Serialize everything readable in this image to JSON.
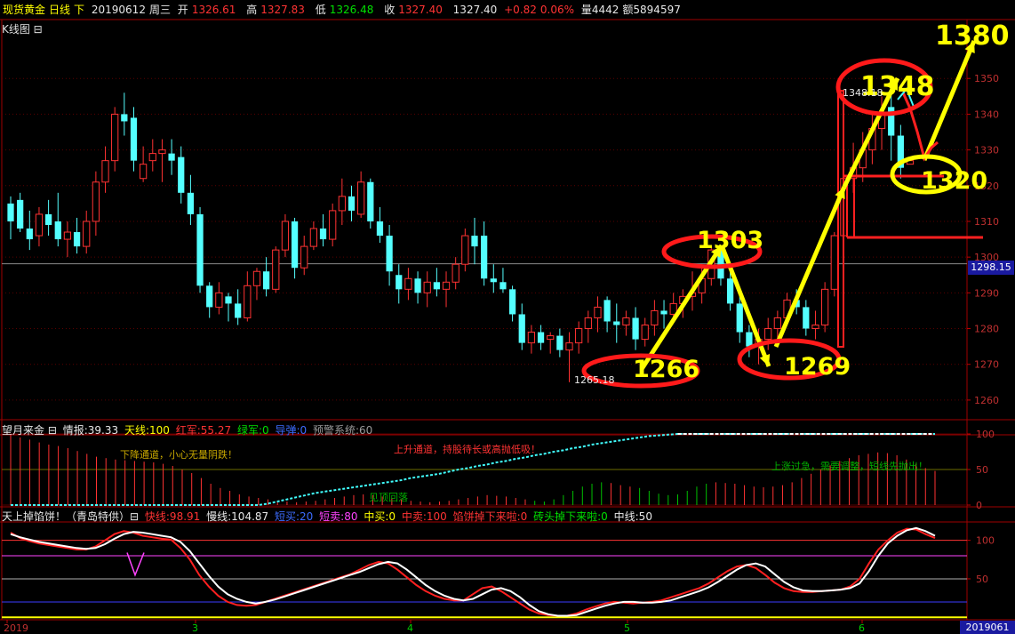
{
  "infobar": {
    "name": "现货黄金",
    "period": "日线",
    "dir": "下",
    "date": "20190612",
    "weekday": "周三",
    "open_label": "开",
    "open": "1326.61",
    "high_label": "高",
    "high": "1327.83",
    "low_label": "低",
    "low": "1326.48",
    "close_label": "收",
    "close": "1327.40",
    "last": "1327.40",
    "change": "+0.82",
    "change_pct": "0.06%",
    "volume": "量4442",
    "amount": "额5894597"
  },
  "kline_label": "K线图 ⊟",
  "price_box": "1298.15",
  "date_box": "2019061",
  "indicator1": {
    "name": "望月来金 ⊟",
    "items": [
      {
        "text": "情报:39.33",
        "color": "#e8e8e8"
      },
      {
        "text": "天线:100",
        "color": "#ffff00"
      },
      {
        "text": "红军:55.27",
        "color": "#ff3333"
      },
      {
        "text": "绿军:0",
        "color": "#00e000"
      },
      {
        "text": "导弹:0",
        "color": "#3c6cff"
      },
      {
        "text": "预警系统:60",
        "color": "#9a9a9a"
      }
    ],
    "notes": [
      "下降通道，小心无量阴跌！",
      "上升通道，持股待长或高抛低吸！",
      "上涨过急，需要调整，短线先抛出！",
      "见顶回落"
    ]
  },
  "indicator2": {
    "name": "天上掉馅饼！（青岛特供）⊟",
    "items": [
      {
        "text": "快线:98.91",
        "color": "#ff3333"
      },
      {
        "text": "慢线:104.87",
        "color": "#e8e8e8"
      },
      {
        "text": "短买:20",
        "color": "#3c6cff"
      },
      {
        "text": "短卖:80",
        "color": "#ff44ff"
      },
      {
        "text": "中买:0",
        "color": "#ffff00"
      },
      {
        "text": "中卖:100",
        "color": "#ff3333"
      },
      {
        "text": "馅饼掉下来啦:0",
        "color": "#ff3333"
      },
      {
        "text": "砖头掉下来啦:0",
        "color": "#00e000"
      },
      {
        "text": "中线:50",
        "color": "#e8e8e8"
      }
    ]
  },
  "xaxis": [
    "2019",
    "3",
    "4",
    "5",
    "6"
  ],
  "annotations": {
    "labels": [
      "1380",
      "1348",
      "1303",
      "1320",
      "1266",
      "1269"
    ],
    "mini_labels": [
      "1348.18",
      "1265.18"
    ]
  },
  "chart_data": {
    "type": "candlestick",
    "title": "现货黄金 日线",
    "price_axis": [
      1260,
      1270,
      1280,
      1290,
      1300,
      1310,
      1320,
      1330,
      1340,
      1350
    ],
    "ylim": [
      1255,
      1362
    ],
    "candles": [
      {
        "o": 1315,
        "h": 1317,
        "l": 1305,
        "c": 1310
      },
      {
        "o": 1316,
        "h": 1318,
        "l": 1307,
        "c": 1308
      },
      {
        "o": 1308,
        "h": 1313,
        "l": 1302,
        "c": 1305
      },
      {
        "o": 1306,
        "h": 1314,
        "l": 1303,
        "c": 1312
      },
      {
        "o": 1312,
        "h": 1316,
        "l": 1306,
        "c": 1309
      },
      {
        "o": 1310,
        "h": 1318,
        "l": 1303,
        "c": 1305
      },
      {
        "o": 1305,
        "h": 1310,
        "l": 1300,
        "c": 1307
      },
      {
        "o": 1307,
        "h": 1311,
        "l": 1301,
        "c": 1303
      },
      {
        "o": 1303,
        "h": 1313,
        "l": 1301,
        "c": 1310
      },
      {
        "o": 1310,
        "h": 1324,
        "l": 1306,
        "c": 1321
      },
      {
        "o": 1321,
        "h": 1331,
        "l": 1318,
        "c": 1327
      },
      {
        "o": 1327,
        "h": 1342,
        "l": 1324,
        "c": 1340
      },
      {
        "o": 1340,
        "h": 1346,
        "l": 1334,
        "c": 1338
      },
      {
        "o": 1339,
        "h": 1342,
        "l": 1324,
        "c": 1327
      },
      {
        "o": 1322,
        "h": 1331,
        "l": 1321,
        "c": 1326
      },
      {
        "o": 1327,
        "h": 1333,
        "l": 1324,
        "c": 1329
      },
      {
        "o": 1329,
        "h": 1333,
        "l": 1321,
        "c": 1330
      },
      {
        "o": 1329,
        "h": 1333,
        "l": 1323,
        "c": 1327
      },
      {
        "o": 1328,
        "h": 1331,
        "l": 1315,
        "c": 1318
      },
      {
        "o": 1318,
        "h": 1323,
        "l": 1309,
        "c": 1312
      },
      {
        "o": 1312,
        "h": 1314,
        "l": 1290,
        "c": 1292
      },
      {
        "o": 1292,
        "h": 1293,
        "l": 1283,
        "c": 1286
      },
      {
        "o": 1286,
        "h": 1293,
        "l": 1284,
        "c": 1290
      },
      {
        "o": 1289,
        "h": 1290,
        "l": 1282,
        "c": 1287
      },
      {
        "o": 1287,
        "h": 1291,
        "l": 1281,
        "c": 1283
      },
      {
        "o": 1283,
        "h": 1296,
        "l": 1282,
        "c": 1292
      },
      {
        "o": 1292,
        "h": 1297,
        "l": 1288,
        "c": 1296
      },
      {
        "o": 1296,
        "h": 1300,
        "l": 1289,
        "c": 1291
      },
      {
        "o": 1291,
        "h": 1303,
        "l": 1290,
        "c": 1302
      },
      {
        "o": 1302,
        "h": 1312,
        "l": 1300,
        "c": 1310
      },
      {
        "o": 1310,
        "h": 1311,
        "l": 1294,
        "c": 1297
      },
      {
        "o": 1297,
        "h": 1306,
        "l": 1295,
        "c": 1303
      },
      {
        "o": 1303,
        "h": 1310,
        "l": 1302,
        "c": 1308
      },
      {
        "o": 1308,
        "h": 1312,
        "l": 1303,
        "c": 1305
      },
      {
        "o": 1305,
        "h": 1315,
        "l": 1303,
        "c": 1313
      },
      {
        "o": 1313,
        "h": 1322,
        "l": 1309,
        "c": 1317
      },
      {
        "o": 1317,
        "h": 1320,
        "l": 1310,
        "c": 1313
      },
      {
        "o": 1312,
        "h": 1324,
        "l": 1311,
        "c": 1321
      },
      {
        "o": 1321,
        "h": 1322,
        "l": 1308,
        "c": 1310
      },
      {
        "o": 1310,
        "h": 1314,
        "l": 1304,
        "c": 1306
      },
      {
        "o": 1306,
        "h": 1309,
        "l": 1292,
        "c": 1296
      },
      {
        "o": 1295,
        "h": 1298,
        "l": 1287,
        "c": 1291
      },
      {
        "o": 1291,
        "h": 1297,
        "l": 1288,
        "c": 1294
      },
      {
        "o": 1294,
        "h": 1296,
        "l": 1287,
        "c": 1290
      },
      {
        "o": 1290,
        "h": 1296,
        "l": 1286,
        "c": 1293
      },
      {
        "o": 1293,
        "h": 1297,
        "l": 1289,
        "c": 1291
      },
      {
        "o": 1291,
        "h": 1296,
        "l": 1286,
        "c": 1293
      },
      {
        "o": 1293,
        "h": 1300,
        "l": 1291,
        "c": 1298
      },
      {
        "o": 1298,
        "h": 1308,
        "l": 1296,
        "c": 1306
      },
      {
        "o": 1306,
        "h": 1311,
        "l": 1298,
        "c": 1303
      },
      {
        "o": 1306,
        "h": 1310,
        "l": 1292,
        "c": 1294
      },
      {
        "o": 1294,
        "h": 1298,
        "l": 1290,
        "c": 1293
      },
      {
        "o": 1293,
        "h": 1297,
        "l": 1290,
        "c": 1291
      },
      {
        "o": 1291,
        "h": 1292,
        "l": 1282,
        "c": 1284
      },
      {
        "o": 1284,
        "h": 1287,
        "l": 1274,
        "c": 1276
      },
      {
        "o": 1276,
        "h": 1281,
        "l": 1273,
        "c": 1279
      },
      {
        "o": 1279,
        "h": 1281,
        "l": 1274,
        "c": 1276
      },
      {
        "o": 1277,
        "h": 1279,
        "l": 1273,
        "c": 1278
      },
      {
        "o": 1278,
        "h": 1280,
        "l": 1272,
        "c": 1274
      },
      {
        "o": 1274,
        "h": 1279,
        "l": 1265,
        "c": 1276
      },
      {
        "o": 1276,
        "h": 1282,
        "l": 1273,
        "c": 1280
      },
      {
        "o": 1280,
        "h": 1285,
        "l": 1276,
        "c": 1283
      },
      {
        "o": 1283,
        "h": 1289,
        "l": 1279,
        "c": 1286
      },
      {
        "o": 1288,
        "h": 1289,
        "l": 1279,
        "c": 1282
      },
      {
        "o": 1282,
        "h": 1287,
        "l": 1276,
        "c": 1281
      },
      {
        "o": 1281,
        "h": 1285,
        "l": 1278,
        "c": 1283
      },
      {
        "o": 1283,
        "h": 1286,
        "l": 1274,
        "c": 1277
      },
      {
        "o": 1277,
        "h": 1283,
        "l": 1275,
        "c": 1281
      },
      {
        "o": 1281,
        "h": 1288,
        "l": 1278,
        "c": 1285
      },
      {
        "o": 1285,
        "h": 1288,
        "l": 1280,
        "c": 1284
      },
      {
        "o": 1284,
        "h": 1290,
        "l": 1282,
        "c": 1287
      },
      {
        "o": 1287,
        "h": 1291,
        "l": 1283,
        "c": 1289
      },
      {
        "o": 1289,
        "h": 1296,
        "l": 1285,
        "c": 1290
      },
      {
        "o": 1290,
        "h": 1298,
        "l": 1287,
        "c": 1294
      },
      {
        "o": 1294,
        "h": 1303,
        "l": 1292,
        "c": 1302
      },
      {
        "o": 1302,
        "h": 1303,
        "l": 1292,
        "c": 1294
      },
      {
        "o": 1294,
        "h": 1297,
        "l": 1285,
        "c": 1287
      },
      {
        "o": 1287,
        "h": 1289,
        "l": 1276,
        "c": 1279
      },
      {
        "o": 1279,
        "h": 1281,
        "l": 1272,
        "c": 1275
      },
      {
        "o": 1275,
        "h": 1280,
        "l": 1270,
        "c": 1277
      },
      {
        "o": 1277,
        "h": 1283,
        "l": 1274,
        "c": 1280
      },
      {
        "o": 1280,
        "h": 1285,
        "l": 1276,
        "c": 1283
      },
      {
        "o": 1283,
        "h": 1290,
        "l": 1281,
        "c": 1288
      },
      {
        "o": 1288,
        "h": 1291,
        "l": 1284,
        "c": 1286
      },
      {
        "o": 1286,
        "h": 1288,
        "l": 1278,
        "c": 1280
      },
      {
        "o": 1280,
        "h": 1285,
        "l": 1277,
        "c": 1281
      },
      {
        "o": 1281,
        "h": 1293,
        "l": 1279,
        "c": 1291
      },
      {
        "o": 1291,
        "h": 1307,
        "l": 1289,
        "c": 1306
      },
      {
        "o": 1306,
        "h": 1325,
        "l": 1304,
        "c": 1322
      },
      {
        "o": 1322,
        "h": 1332,
        "l": 1318,
        "c": 1325
      },
      {
        "o": 1325,
        "h": 1335,
        "l": 1321,
        "c": 1330
      },
      {
        "o": 1330,
        "h": 1340,
        "l": 1326,
        "c": 1336
      },
      {
        "o": 1336,
        "h": 1345,
        "l": 1330,
        "c": 1340
      },
      {
        "o": 1342,
        "h": 1348,
        "l": 1327,
        "c": 1334
      },
      {
        "o": 1334,
        "h": 1337,
        "l": 1322,
        "c": 1325
      },
      {
        "o": 1326,
        "h": 1328,
        "l": 1326,
        "c": 1327
      }
    ],
    "indicator1": {
      "ylim": [
        0,
        100
      ],
      "levels": [
        0,
        50,
        100
      ],
      "tianxian": [
        0,
        0,
        0,
        0,
        0,
        0,
        0,
        0,
        0,
        0,
        0,
        0,
        0,
        0,
        0,
        0,
        0,
        0,
        0,
        0,
        0,
        0,
        0,
        0,
        0,
        0,
        0,
        2,
        5,
        8,
        11,
        14,
        17,
        19,
        21,
        23,
        25,
        27,
        29,
        31,
        33,
        35,
        38,
        40,
        42,
        44,
        47,
        50,
        52,
        55,
        57,
        60,
        62,
        65,
        67,
        70,
        72,
        75,
        77,
        80,
        82,
        85,
        87,
        89,
        91,
        93,
        95,
        97,
        98,
        99,
        100,
        100,
        100,
        100,
        100,
        100,
        100,
        100,
        100,
        100,
        100,
        100,
        100,
        100,
        100,
        100,
        100,
        100,
        100,
        100,
        100,
        100,
        100,
        100,
        100,
        100,
        100,
        100
      ],
      "hongjun": [
        100,
        95,
        92,
        88,
        85,
        83,
        80,
        76,
        72,
        68,
        66,
        64,
        63,
        62,
        61,
        60,
        58,
        55,
        50,
        45,
        38,
        30,
        24,
        20,
        15,
        12,
        10,
        8,
        6,
        5,
        4,
        5,
        6,
        8,
        10,
        12,
        14,
        15,
        14,
        12,
        10,
        8,
        6,
        5,
        4,
        5,
        6,
        8,
        10,
        12,
        14,
        13,
        12,
        10,
        8,
        6,
        5,
        8,
        14,
        20,
        26,
        30,
        32,
        31,
        28,
        26,
        24,
        20,
        16,
        14,
        15,
        20,
        26,
        30,
        32,
        31,
        30,
        28,
        26,
        25,
        26,
        28,
        32,
        38,
        44,
        50,
        56,
        62,
        66,
        70,
        72,
        74,
        73,
        70,
        64,
        58,
        52,
        48
      ]
    },
    "indicator2": {
      "ylim": [
        -2,
        125
      ],
      "levels": [
        0,
        20,
        50,
        80,
        100
      ],
      "fast": [
        110,
        103,
        99,
        96,
        94,
        92,
        90,
        88,
        88,
        92,
        100,
        108,
        112,
        110,
        106,
        104,
        102,
        101,
        90,
        75,
        55,
        40,
        28,
        20,
        16,
        15,
        16,
        20,
        24,
        28,
        32,
        36,
        40,
        44,
        48,
        52,
        56,
        62,
        68,
        72,
        70,
        62,
        52,
        42,
        34,
        28,
        24,
        22,
        22,
        30,
        38,
        40,
        34,
        26,
        18,
        10,
        5,
        3,
        2,
        2,
        5,
        10,
        14,
        18,
        20,
        19,
        18,
        19,
        20,
        22,
        26,
        30,
        34,
        38,
        44,
        52,
        60,
        66,
        68,
        64,
        55,
        45,
        38,
        34,
        33,
        33,
        34,
        35,
        36,
        40,
        50,
        70,
        88,
        100,
        110,
        115,
        114,
        108,
        103
      ],
      "slow": [
        108,
        104,
        101,
        98,
        96,
        94,
        92,
        90,
        89,
        90,
        95,
        102,
        108,
        111,
        110,
        108,
        106,
        104,
        98,
        86,
        70,
        54,
        40,
        30,
        24,
        20,
        18,
        20,
        23,
        27,
        31,
        35,
        39,
        43,
        47,
        51,
        55,
        59,
        64,
        69,
        72,
        70,
        62,
        52,
        42,
        34,
        28,
        24,
        22,
        24,
        30,
        36,
        38,
        34,
        26,
        16,
        8,
        4,
        2,
        2,
        3,
        7,
        11,
        15,
        18,
        20,
        20,
        19,
        19,
        20,
        22,
        26,
        30,
        34,
        39,
        46,
        54,
        62,
        68,
        70,
        66,
        56,
        46,
        39,
        35,
        34,
        34,
        35,
        36,
        38,
        44,
        60,
        80,
        96,
        106,
        113,
        116,
        112,
        106
      ]
    }
  }
}
